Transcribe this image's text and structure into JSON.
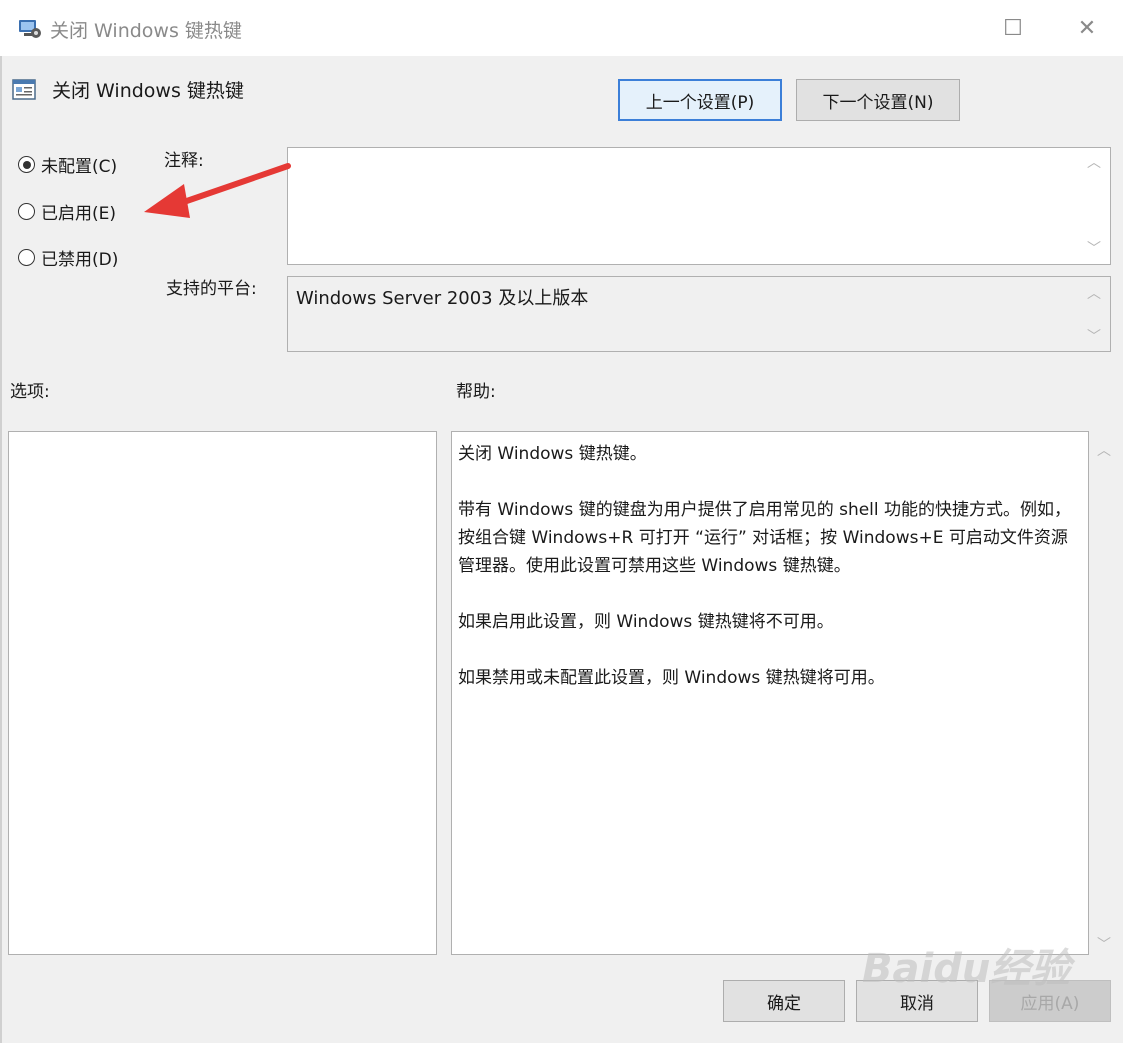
{
  "window": {
    "title": "关闭 Windows 键热键",
    "controls": {
      "minimize": "—",
      "maximize": "☐",
      "close": "✕"
    }
  },
  "policy": {
    "title": "关闭 Windows 键热键"
  },
  "nav": {
    "prev_label": "上一个设置(P)",
    "next_label": "下一个设置(N)"
  },
  "state": {
    "options": [
      {
        "label": "未配置(C)",
        "checked": true
      },
      {
        "label": "已启用(E)",
        "checked": false
      },
      {
        "label": "已禁用(D)",
        "checked": false
      }
    ]
  },
  "comment": {
    "label": "注释:",
    "value": ""
  },
  "platform": {
    "label": "支持的平台:",
    "value": "Windows Server 2003 及以上版本"
  },
  "options_section": {
    "label": "选项:"
  },
  "help": {
    "label": "帮助:",
    "paragraphs": [
      "关闭 Windows 键热键。",
      "带有 Windows 键的键盘为用户提供了启用常见的 shell 功能的快捷方式。例如，按组合键 Windows+R 可打开 “运行” 对话框；按 Windows+E 可启动文件资源管理器。使用此设置可禁用这些 Windows 键热键。",
      "如果启用此设置，则 Windows 键热键将不可用。",
      "如果禁用或未配置此设置，则 Windows 键热键将可用。"
    ]
  },
  "footer": {
    "ok_label": "确定",
    "cancel_label": "取消",
    "apply_label": "应用(A)"
  },
  "watermark": {
    "text": "Baidu经验"
  },
  "colors": {
    "annotation_arrow": "#e53935",
    "focus_border": "#3c7fd8"
  },
  "icons": {
    "app": "group-policy-icon",
    "policy": "policy-setting-icon"
  }
}
